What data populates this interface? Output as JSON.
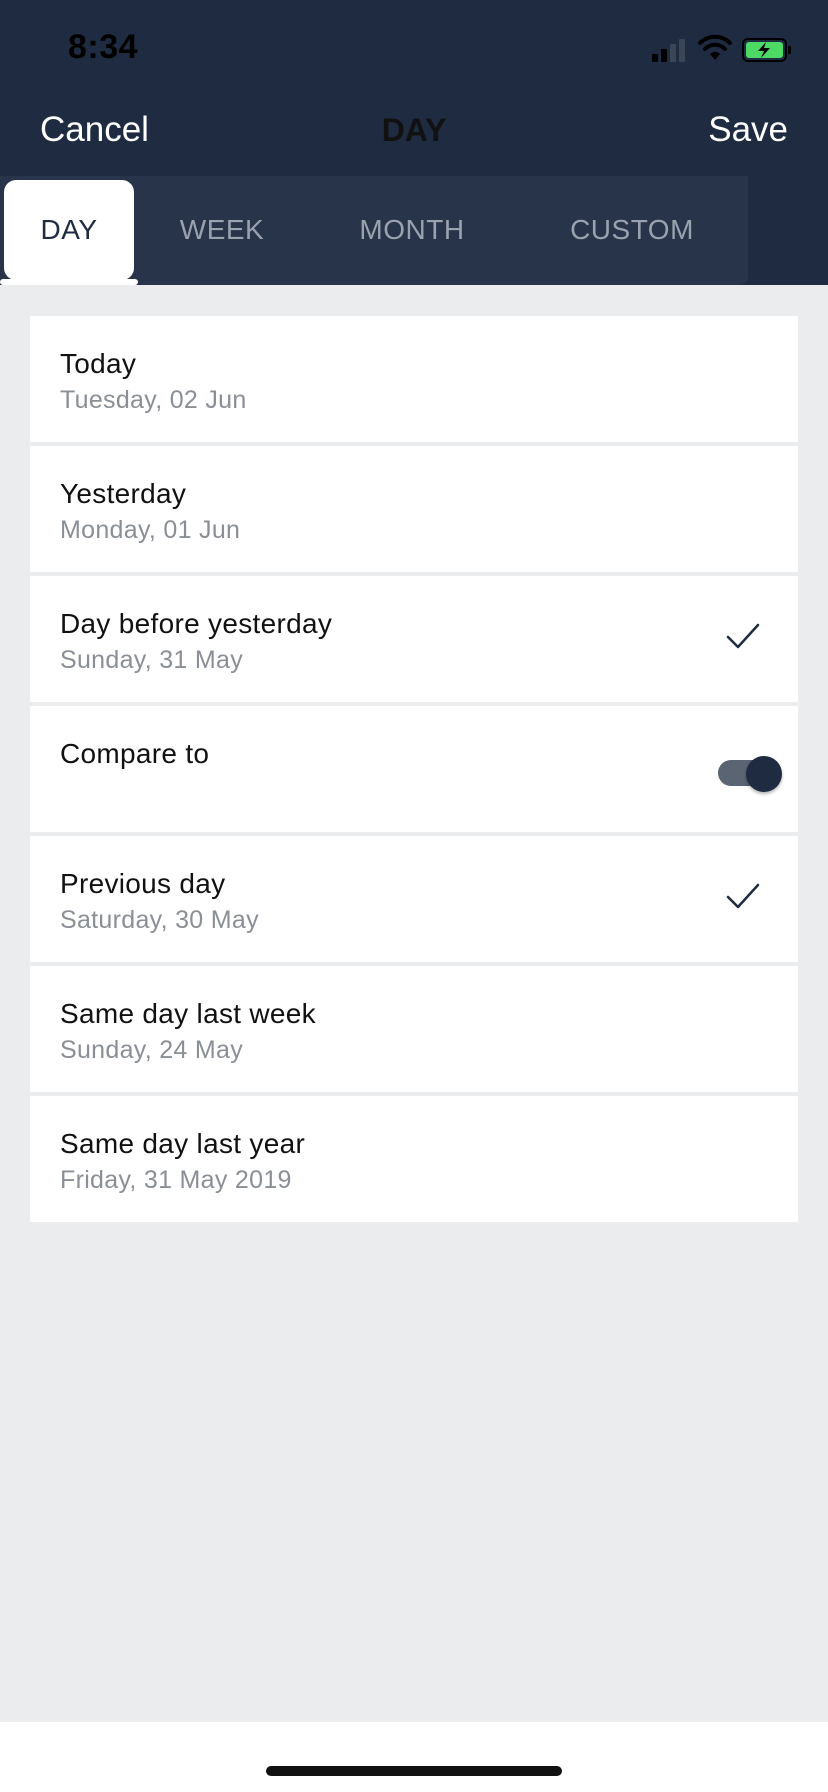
{
  "status_bar": {
    "time": "8:34",
    "icons": [
      "cellular-signal-icon",
      "wifi-icon",
      "battery-charging-icon"
    ]
  },
  "nav": {
    "cancel_label": "Cancel",
    "title": "DAY",
    "save_label": "Save"
  },
  "tabs": [
    {
      "label": "DAY",
      "active": true
    },
    {
      "label": "WEEK",
      "active": false
    },
    {
      "label": "MONTH",
      "active": false
    },
    {
      "label": "CUSTOM",
      "active": false
    }
  ],
  "options": [
    {
      "title": "Today",
      "subtitle": "Tuesday, 02 Jun",
      "selected": false
    },
    {
      "title": "Yesterday",
      "subtitle": "Monday, 01 Jun",
      "selected": false
    },
    {
      "title": "Day before yesterday",
      "subtitle": "Sunday, 31 May",
      "selected": true
    }
  ],
  "compare": {
    "label": "Compare to",
    "enabled": true
  },
  "compare_options": [
    {
      "title": "Previous day",
      "subtitle": "Saturday, 30 May",
      "selected": true
    },
    {
      "title": "Same day last week",
      "subtitle": "Sunday, 24 May",
      "selected": false
    },
    {
      "title": "Same day last year",
      "subtitle": "Friday, 31 May 2019",
      "selected": false
    }
  ],
  "colors": {
    "header_bg": "#1e2b41",
    "tabs_bg": "#27344a",
    "page_bg": "#ebecee",
    "accent": "#1e2b41",
    "battery_green": "#4cd964"
  }
}
